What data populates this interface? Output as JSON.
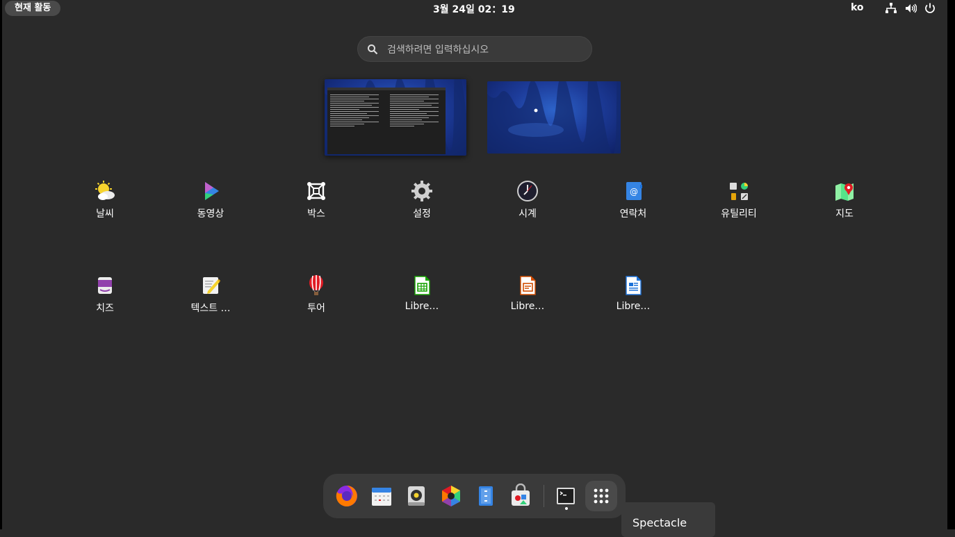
{
  "topbar": {
    "activities": "현재 활동",
    "clock": "3월 24일  02：19",
    "language": "ko",
    "tray_icons": [
      "network-icon",
      "volume-icon",
      "power-icon"
    ]
  },
  "search": {
    "placeholder": "검색하려면 입력하십시오",
    "value": ""
  },
  "workspaces": [
    {
      "name": "workspace-1",
      "has_window": "terminal"
    },
    {
      "name": "workspace-2",
      "has_window": ""
    }
  ],
  "apps": [
    {
      "label": "날씨",
      "icon": "weather-icon"
    },
    {
      "label": "동영상",
      "icon": "videos-icon"
    },
    {
      "label": "박스",
      "icon": "boxes-icon"
    },
    {
      "label": "설정",
      "icon": "settings-icon"
    },
    {
      "label": "시계",
      "icon": "clock-icon"
    },
    {
      "label": "연락처",
      "icon": "contacts-icon"
    },
    {
      "label": "유틸리티",
      "icon": "utilities-folder-icon"
    },
    {
      "label": "지도",
      "icon": "maps-icon"
    },
    {
      "label": "치즈",
      "icon": "cheese-icon"
    },
    {
      "label": "텍스트 …",
      "icon": "text-editor-icon"
    },
    {
      "label": "투어",
      "icon": "tour-icon"
    },
    {
      "label": "Libre…",
      "icon": "libreoffice-calc-icon"
    },
    {
      "label": "Libre…",
      "icon": "libreoffice-impress-icon"
    },
    {
      "label": "Libre…",
      "icon": "libreoffice-writer-icon"
    }
  ],
  "dock": {
    "items": [
      "firefox-icon",
      "calendar-icon",
      "rhythmbox-icon",
      "photos-icon",
      "files-icon",
      "software-icon",
      "terminal-icon",
      "show-apps-icon"
    ],
    "running": "terminal-icon"
  },
  "tooltip": {
    "text": "Spectacle"
  },
  "colors": {
    "background": "#2a2a2a",
    "panel": "#3a3a3a",
    "accent": "#3584e4"
  }
}
